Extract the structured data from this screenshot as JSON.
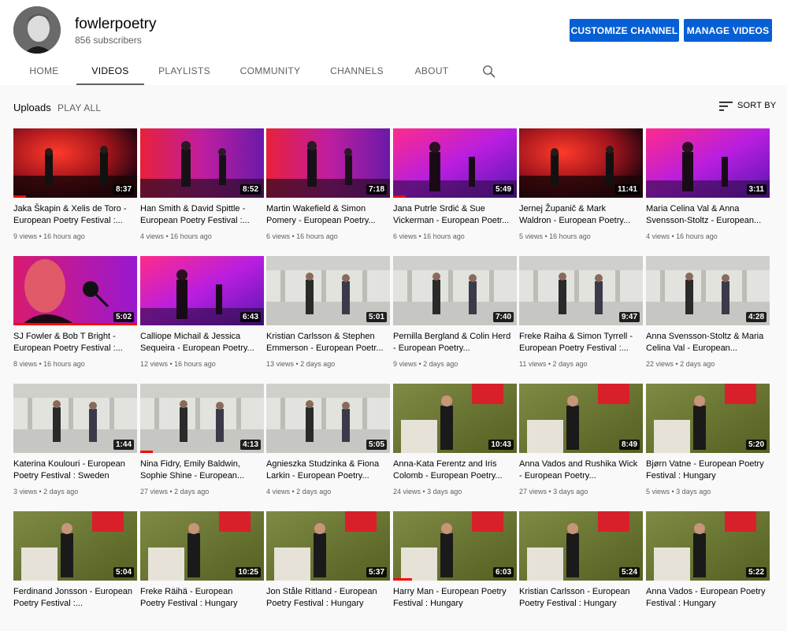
{
  "channel": {
    "name": "fowlerpoetry",
    "subscribers": "856 subscribers",
    "customize_label": "CUSTOMIZE CHANNEL",
    "manage_label": "MANAGE VIDEOS"
  },
  "tabs": [
    {
      "label": "HOME"
    },
    {
      "label": "VIDEOS"
    },
    {
      "label": "PLAYLISTS"
    },
    {
      "label": "COMMUNITY"
    },
    {
      "label": "CHANNELS"
    },
    {
      "label": "ABOUT"
    }
  ],
  "section": {
    "title": "Uploads",
    "play_all": "PLAY ALL",
    "sort_label": "SORT BY"
  },
  "colors": {
    "accent": "#065fd4",
    "progress": "#ff0000"
  },
  "videos": [
    {
      "title": "Jaka Škapin & Xelis de Toro - European Poetry Festival :...",
      "views": "9 views",
      "age": "16 hours ago",
      "duration": "8:37",
      "theme": "red",
      "watched": 0.1
    },
    {
      "title": "Han Smith & David Spittle - European Poetry Festival :...",
      "views": "4 views",
      "age": "16 hours ago",
      "duration": "8:52",
      "theme": "redpurple",
      "watched": 0
    },
    {
      "title": "Martin Wakefield & Simon Pomery - European Poetry...",
      "views": "6 views",
      "age": "16 hours ago",
      "duration": "7:18",
      "theme": "redpurple",
      "watched": 0
    },
    {
      "title": "Jana Putrle Srdić & Sue Vickerman - European Poetr...",
      "views": "6 views",
      "age": "16 hours ago",
      "duration": "5:49",
      "theme": "purple",
      "watched": 0.1
    },
    {
      "title": "Jernej Županič & Mark Waldron - European Poetry...",
      "views": "5 views",
      "age": "16 hours ago",
      "duration": "11:41",
      "theme": "red",
      "watched": 0
    },
    {
      "title": "Maria Celina Val & Anna Svensson-Stoltz - European...",
      "views": "4 views",
      "age": "16 hours ago",
      "duration": "3:11",
      "theme": "purple",
      "watched": 0
    },
    {
      "title": "SJ Fowler & Bob T Bright - European Poetry Festival :...",
      "views": "8 views",
      "age": "16 hours ago",
      "duration": "5:02",
      "theme": "closeup",
      "watched": 1
    },
    {
      "title": "Calliope Michail & Jessica Sequeira - European Poetry...",
      "views": "12 views",
      "age": "16 hours ago",
      "duration": "6:43",
      "theme": "purple",
      "watched": 0
    },
    {
      "title": "Kristian Carlsson & Stephen Emmerson - European Poetr...",
      "views": "13 views",
      "age": "2 days ago",
      "duration": "5:01",
      "theme": "hall",
      "watched": 0
    },
    {
      "title": "Pernilla Bergland & Colin Herd - European Poetry...",
      "views": "9 views",
      "age": "2 days ago",
      "duration": "7:40",
      "theme": "hall",
      "watched": 0
    },
    {
      "title": "Freke Raiha & Simon Tyrrell - European Poetry Festival :...",
      "views": "11 views",
      "age": "2 days ago",
      "duration": "9:47",
      "theme": "hall",
      "watched": 0
    },
    {
      "title": "Anna Svensson-Stoltz & Maria Celina Val - European...",
      "views": "22 views",
      "age": "2 days ago",
      "duration": "4:28",
      "theme": "hall",
      "watched": 0
    },
    {
      "title": "Katerina Koulouri - European Poetry Festival : Sweden",
      "views": "3 views",
      "age": "2 days ago",
      "duration": "1:44",
      "theme": "hall",
      "watched": 0
    },
    {
      "title": "Nina Fidry, Emily Baldwin, Sophie Shine - European...",
      "views": "27 views",
      "age": "2 days ago",
      "duration": "4:13",
      "theme": "hall",
      "watched": 0.1
    },
    {
      "title": "Agnieszka Studzinka & Fiona Larkin - European Poetry...",
      "views": "4 views",
      "age": "2 days ago",
      "duration": "5:05",
      "theme": "hall",
      "watched": 0
    },
    {
      "title": "Anna-Kata Ferentz and Iris Colomb - European Poetry...",
      "views": "24 views",
      "age": "3 days ago",
      "duration": "10:43",
      "theme": "green",
      "watched": 0
    },
    {
      "title": "Anna Vados and Rushika Wick - European Poetry...",
      "views": "27 views",
      "age": "3 days ago",
      "duration": "8:49",
      "theme": "green",
      "watched": 0
    },
    {
      "title": "Bjørn Vatne - European Poetry Festival : Hungary",
      "views": "5 views",
      "age": "3 days ago",
      "duration": "5:20",
      "theme": "green",
      "watched": 0
    },
    {
      "title": "Ferdinand Jonsson - European Poetry Festival :...",
      "views": "",
      "age": "",
      "duration": "5:04",
      "theme": "green",
      "watched": 0
    },
    {
      "title": "Freke Räihä - European Poetry Festival : Hungary",
      "views": "",
      "age": "",
      "duration": "10:25",
      "theme": "green",
      "watched": 0
    },
    {
      "title": "Jon Ståle Ritland - European Poetry Festival : Hungary",
      "views": "",
      "age": "",
      "duration": "5:37",
      "theme": "green",
      "watched": 0
    },
    {
      "title": "Harry Man - European Poetry Festival : Hungary",
      "views": "",
      "age": "",
      "duration": "6:03",
      "theme": "green",
      "watched": 0.15
    },
    {
      "title": "Kristian Carlsson - European Poetry Festival : Hungary",
      "views": "",
      "age": "",
      "duration": "5:24",
      "theme": "green",
      "watched": 0
    },
    {
      "title": "Anna Vados - European Poetry Festival : Hungary",
      "views": "",
      "age": "",
      "duration": "5:22",
      "theme": "green",
      "watched": 0
    }
  ]
}
